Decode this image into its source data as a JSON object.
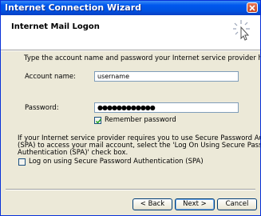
{
  "window": {
    "title": "Internet Connection Wizard",
    "close_icon": "close-icon"
  },
  "header": {
    "title": "Internet Mail Logon",
    "icon": "wizard-sparkle-icon"
  },
  "body": {
    "intro": "Type the account name and password your Internet service provider has given you.",
    "account_label": "Account name:",
    "account_value": "username",
    "password_label": "Password:",
    "password_value": "●●●●●●●●●●●●",
    "remember_label": "Remember password",
    "remember_checked": true,
    "spa_text": [
      "If your Internet service provider requires you to use Secure Password Authentication",
      "(SPA) to access your mail account, select the 'Log On Using Secure Password",
      "Authentication (SPA)' check box."
    ],
    "spa_checkbox_label": "Log on using Secure Password Authentication (SPA)",
    "spa_checked": false
  },
  "buttons": {
    "back": "< Back",
    "next": "Next >",
    "cancel": "Cancel"
  }
}
